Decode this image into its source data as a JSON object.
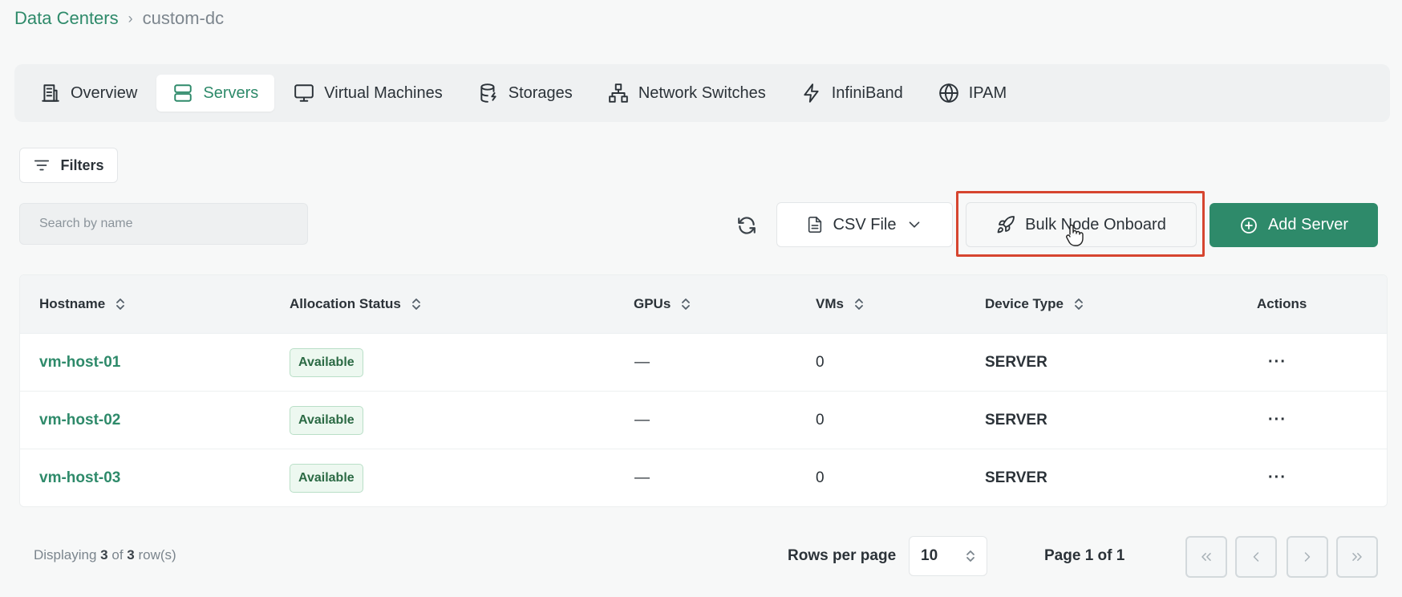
{
  "breadcrumb": {
    "root": "Data Centers",
    "separator": "›",
    "current": "custom-dc"
  },
  "tabs": [
    {
      "label": "Overview",
      "icon": "building-icon",
      "active": false
    },
    {
      "label": "Servers",
      "icon": "server-icon",
      "active": true
    },
    {
      "label": "Virtual Machines",
      "icon": "monitor-icon",
      "active": false
    },
    {
      "label": "Storages",
      "icon": "database-icon",
      "active": false
    },
    {
      "label": "Network Switches",
      "icon": "network-icon",
      "active": false
    },
    {
      "label": "InfiniBand",
      "icon": "lightning-icon",
      "active": false
    },
    {
      "label": "IPAM",
      "icon": "globe-icon",
      "active": false
    }
  ],
  "toolbar": {
    "filters_label": "Filters",
    "search_placeholder": "Search by name",
    "csv_label": "CSV File",
    "bulk_label": "Bulk Node Onboard",
    "add_label": "Add Server"
  },
  "table": {
    "columns": {
      "hostname": "Hostname",
      "allocation": "Allocation Status",
      "gpus": "GPUs",
      "vms": "VMs",
      "device_type": "Device Type",
      "actions": "Actions"
    },
    "rows": [
      {
        "hostname": "vm-host-01",
        "status": "Available",
        "gpus": "—",
        "vms": "0",
        "device_type": "SERVER",
        "actions": "···"
      },
      {
        "hostname": "vm-host-02",
        "status": "Available",
        "gpus": "—",
        "vms": "0",
        "device_type": "SERVER",
        "actions": "···"
      },
      {
        "hostname": "vm-host-03",
        "status": "Available",
        "gpus": "—",
        "vms": "0",
        "device_type": "SERVER",
        "actions": "···"
      }
    ]
  },
  "footer": {
    "displaying_prefix": "Displaying",
    "shown": "3",
    "of": "of",
    "total": "3",
    "suffix": "row(s)",
    "rows_per_page_label": "Rows per page",
    "rows_per_page_value": "10",
    "page_info": "Page 1 of 1"
  },
  "colors": {
    "accent": "#2e8a6a",
    "highlight": "#d6452f"
  }
}
